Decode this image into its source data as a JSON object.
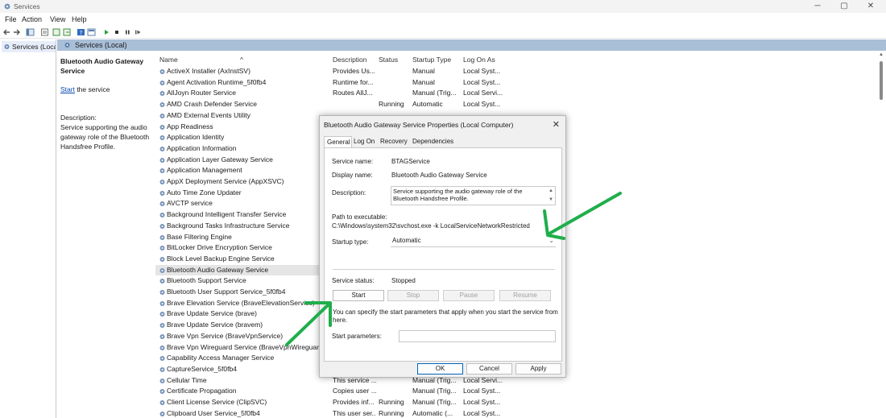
{
  "window": {
    "title": "Services",
    "minimize": "─",
    "maximize": "▢",
    "close": "✕"
  },
  "menu": {
    "file": "File",
    "action": "Action",
    "view": "View",
    "help": "Help"
  },
  "tree": {
    "node_label": "Services (Local"
  },
  "header": {
    "title": "Services (Local)"
  },
  "left_pane": {
    "service_name": "Bluetooth Audio Gateway Service",
    "start_link": "Start",
    "start_suffix": " the service",
    "description_label": "Description:",
    "description": "Service supporting the audio gateway role of the Bluetooth Handsfree Profile."
  },
  "columns": {
    "name": "Name",
    "description": "Description",
    "status": "Status",
    "startup_type": "Startup Type",
    "log_on_as": "Log On As"
  },
  "services": [
    {
      "name": "ActiveX Installer (AxInstSV)",
      "description": "Provides Us...",
      "status": "",
      "startup": "Manual",
      "logon": "Local Syst..."
    },
    {
      "name": "Agent Activation Runtime_5f0fb4",
      "description": "Runtime for...",
      "status": "",
      "startup": "Manual",
      "logon": "Local Syst..."
    },
    {
      "name": "AllJoyn Router Service",
      "description": "Routes AllJ...",
      "status": "",
      "startup": "Manual (Trig...",
      "logon": "Local Servi..."
    },
    {
      "name": "AMD Crash Defender Service",
      "description": "",
      "status": "Running",
      "startup": "Automatic",
      "logon": "Local Syst..."
    },
    {
      "name": "AMD External Events Utility",
      "description": "",
      "status": "",
      "startup": "",
      "logon": ""
    },
    {
      "name": "App Readiness",
      "description": "",
      "status": "",
      "startup": "",
      "logon": ""
    },
    {
      "name": "Application Identity",
      "description": "",
      "status": "",
      "startup": "",
      "logon": ""
    },
    {
      "name": "Application Information",
      "description": "",
      "status": "",
      "startup": "",
      "logon": ""
    },
    {
      "name": "Application Layer Gateway Service",
      "description": "",
      "status": "",
      "startup": "",
      "logon": ""
    },
    {
      "name": "Application Management",
      "description": "",
      "status": "",
      "startup": "",
      "logon": ""
    },
    {
      "name": "AppX Deployment Service (AppXSVC)",
      "description": "",
      "status": "",
      "startup": "",
      "logon": ""
    },
    {
      "name": "Auto Time Zone Updater",
      "description": "",
      "status": "",
      "startup": "",
      "logon": ""
    },
    {
      "name": "AVCTP service",
      "description": "",
      "status": "",
      "startup": "",
      "logon": ""
    },
    {
      "name": "Background Intelligent Transfer Service",
      "description": "",
      "status": "",
      "startup": "",
      "logon": ""
    },
    {
      "name": "Background Tasks Infrastructure Service",
      "description": "",
      "status": "",
      "startup": "",
      "logon": ""
    },
    {
      "name": "Base Filtering Engine",
      "description": "",
      "status": "",
      "startup": "",
      "logon": ""
    },
    {
      "name": "BitLocker Drive Encryption Service",
      "description": "",
      "status": "",
      "startup": "",
      "logon": ""
    },
    {
      "name": "Block Level Backup Engine Service",
      "description": "",
      "status": "",
      "startup": "",
      "logon": ""
    },
    {
      "name": "Bluetooth Audio Gateway Service",
      "description": "",
      "status": "",
      "startup": "",
      "logon": "",
      "selected": true
    },
    {
      "name": "Bluetooth Support Service",
      "description": "",
      "status": "",
      "startup": "",
      "logon": ""
    },
    {
      "name": "Bluetooth User Support Service_5f0fb4",
      "description": "",
      "status": "",
      "startup": "",
      "logon": ""
    },
    {
      "name": "Brave Elevation Service (BraveElevationService)",
      "description": "",
      "status": "",
      "startup": "",
      "logon": ""
    },
    {
      "name": "Brave Update Service (brave)",
      "description": "",
      "status": "",
      "startup": "",
      "logon": ""
    },
    {
      "name": "Brave Update Service (bravem)",
      "description": "",
      "status": "",
      "startup": "",
      "logon": ""
    },
    {
      "name": "Brave Vpn Service (BraveVpnService)",
      "description": "",
      "status": "",
      "startup": "",
      "logon": ""
    },
    {
      "name": "Brave Vpn Wireguard Service (BraveVpnWireguard",
      "description": "",
      "status": "",
      "startup": "",
      "logon": ""
    },
    {
      "name": "Capability Access Manager Service",
      "description": "",
      "status": "",
      "startup": "",
      "logon": ""
    },
    {
      "name": "CaptureService_5f0fb4",
      "description": "",
      "status": "",
      "startup": "",
      "logon": ""
    },
    {
      "name": "Cellular Time",
      "description": "This service ...",
      "status": "",
      "startup": "Manual (Trig...",
      "logon": "Local Servi..."
    },
    {
      "name": "Certificate Propagation",
      "description": "Copies user ...",
      "status": "",
      "startup": "Manual (Trig...",
      "logon": "Local Syst..."
    },
    {
      "name": "Client License Service (ClipSVC)",
      "description": "Provides inf...",
      "status": "Running",
      "startup": "Manual (Trig...",
      "logon": "Local Syst..."
    },
    {
      "name": "Clipboard User Service_5f0fb4",
      "description": "This user ser...",
      "status": "Running",
      "startup": "Automatic (...",
      "logon": "Local Syst..."
    }
  ],
  "dialog": {
    "title": "Bluetooth Audio Gateway Service Properties (Local Computer)",
    "close": "✕",
    "tabs": [
      "General",
      "Log On",
      "Recovery",
      "Dependencies"
    ],
    "service_name_label": "Service name:",
    "service_name": "BTAGService",
    "display_name_label": "Display name:",
    "display_name": "Bluetooth Audio Gateway Service",
    "description_label": "Description:",
    "description": "Service supporting the audio gateway role of the Bluetooth Handsfree Profile.",
    "path_label": "Path to executable:",
    "path": "C:\\Windows\\system32\\svchost.exe -k LocalServiceNetworkRestricted",
    "startup_type_label": "Startup type:",
    "startup_type": "Automatic",
    "service_status_label": "Service status:",
    "service_status": "Stopped",
    "buttons": {
      "start": "Start",
      "stop": "Stop",
      "pause": "Pause",
      "resume": "Resume"
    },
    "help_text": "You can specify the start parameters that apply when you start the service from here.",
    "start_params_label": "Start parameters:",
    "start_params_value": "",
    "ok": "OK",
    "cancel": "Cancel",
    "apply": "Apply"
  },
  "colors": {
    "header_band": "#a9bfd8",
    "selection": "#e5e5e5",
    "annotation_arrow": "#1fae4b",
    "primary_border": "#0067c0"
  },
  "icons": {
    "services_app": "gear-icon",
    "back": "back-arrow-icon",
    "forward": "forward-arrow-icon",
    "play": "play-icon",
    "stop": "stop-icon",
    "pause": "pause-icon",
    "restart": "restart-icon"
  }
}
